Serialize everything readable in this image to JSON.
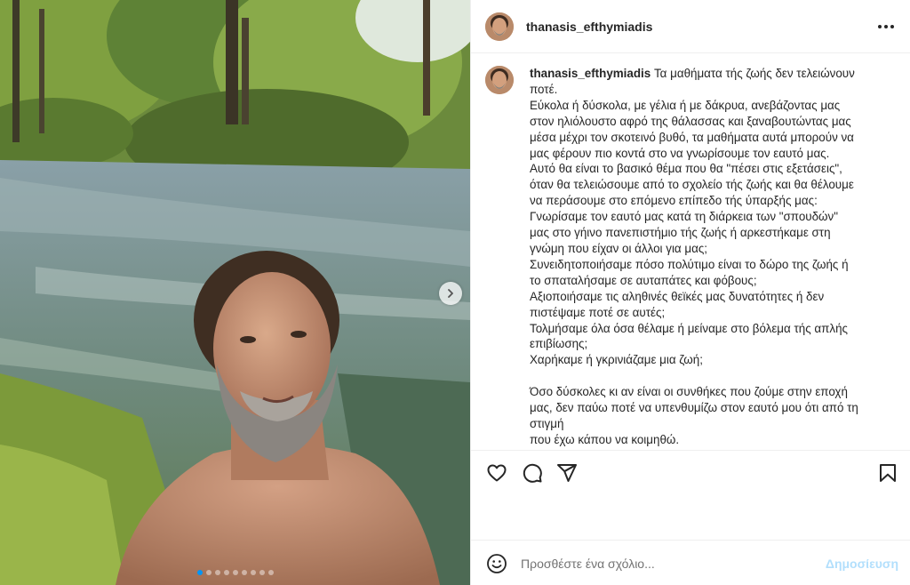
{
  "post": {
    "username": "thanasis_efthymiadis",
    "more_icon": "more-horizontal-icon"
  },
  "media": {
    "next_icon": "chevron-right-icon",
    "slide_count": 9,
    "active_slide": 1
  },
  "caption": {
    "username": "thanasis_efthymiadis",
    "first_line": "Τα μαθήματα τής ζωής δεν τελειώνουν",
    "lines": [
      "ποτέ.",
      "Εύκολα ή δύσκολα, με γέλια ή με δάκρυα, ανεβάζοντας μας",
      "στον ηλιόλουστο αφρό της θάλασσας και ξαναβουτώντας μας",
      "μέσα μέχρι τον σκοτεινό βυθό, τα μαθήματα αυτά μπορούν να",
      "μας φέρουν πιο κοντά στο να γνωρίσουμε τον εαυτό μας.",
      "Αυτό θα είναι το βασικό θέμα που θα \"πέσει στις εξετάσεις\",",
      "όταν θα τελειώσουμε από το σχολείο τής ζωής και θα θέλουμε",
      "να περάσουμε στο επόμενο επίπεδο τής ύπαρξής μας:",
      "Γνωρίσαμε τον εαυτό μας κατά τη διάρκεια των \"σπουδών\"",
      "μας στο γήινο πανεπιστήμιο τής ζωής ή αρκεστήκαμε στη",
      "γνώμη που είχαν οι άλλοι για μας;",
      "Συνειδητοποιήσαμε πόσο πολύτιμο είναι το δώρο της ζωής ή",
      "το σπαταλήσαμε σε αυταπάτες και φόβους;",
      "Αξιοποιήσαμε τις αληθινές θεϊκές μας δυνατότητες ή δεν",
      "πιστέψαμε ποτέ σε αυτές;",
      "Τολμήσαμε όλα όσα θέλαμε ή μείναμε στο βόλεμα τής απλής",
      "επιβίωσης;",
      "Χαρήκαμε ή γκρινιάζαμε μια ζωή;",
      "",
      "Όσο δύσκολες κι αν είναι οι συνθήκες που ζούμε στην εποχή",
      "μας, δεν παύω ποτέ να υπενθυμίζω στον εαυτό μου ότι από τη",
      "στιγμή",
      "που έχω κάπου να κοιμηθώ."
    ]
  },
  "actions": {
    "like_icon": "heart-icon",
    "comment_icon": "comment-icon",
    "share_icon": "send-icon",
    "save_icon": "bookmark-icon"
  },
  "comment": {
    "emoji_icon": "emoji-icon",
    "placeholder": "Προσθέστε ένα σχόλιο...",
    "post_label": "Δημοσίευση"
  },
  "colors": {
    "accent": "#0095f6",
    "post_disabled": "#b2dffc",
    "text": "#262626",
    "border": "#efefef"
  }
}
